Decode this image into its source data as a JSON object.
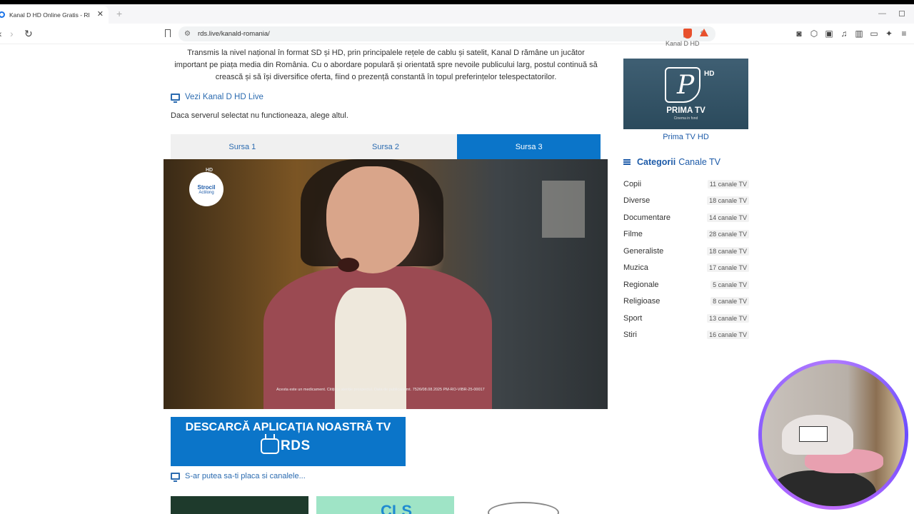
{
  "browser": {
    "tab_title": "Kanal D HD Online Gratis - RD",
    "tab_close": "✕",
    "new_tab": "+",
    "url": "rds.live/kanald-romania/",
    "window_min": "—"
  },
  "article": {
    "intro": "Transmis la nivel național în format SD și HD, prin principalele rețele de cablu și satelit, Kanal D rămâne un jucător important pe piața media din România. Cu o abordare populară și orientată spre nevoile publicului larg, postul continuă să crească și să își diversifice oferta, fiind o prezență constantă în topul preferințelor telespectatorilor.",
    "live_link": "Vezi Kanal D HD Live",
    "server_note": "Daca serverul selectat nu functioneaza, alege altul.",
    "sources": [
      "Sursa 1",
      "Sursa 2",
      "Sursa 3"
    ],
    "active_source": "Sursa 3",
    "video_logo_line1": "Strocil",
    "video_logo_line2": "Actilong",
    "video_logo_hd": "HD",
    "video_caption": "Acesta este un medicament. Citiți cu atenție prospectul. Data de publicare mt. 7526/08.08.2025 PM-RO-VIBR-25-00017",
    "app_banner_title": "DESCARCĂ APLICAȚIA NOASTRĂ TV",
    "app_banner_brand": "RDS",
    "related_link": "S-ar putea sa-ti placa si canalele...",
    "thumb_2_text": "CLS"
  },
  "sidebar": {
    "cut_label": "Kanal D HD",
    "prima_hd": "HD",
    "prima_word": "PRIMA TV",
    "prima_tag": "Cinema in fond",
    "prima_label": "Prima TV HD",
    "categories_title_strong": "Categorii",
    "categories_title_rest": "Canale TV",
    "categories": [
      {
        "name": "Copii",
        "count": "11 canale TV"
      },
      {
        "name": "Diverse",
        "count": "18 canale TV"
      },
      {
        "name": "Documentare",
        "count": "14 canale TV"
      },
      {
        "name": "Filme",
        "count": "28 canale TV"
      },
      {
        "name": "Generaliste",
        "count": "18 canale TV"
      },
      {
        "name": "Muzica",
        "count": "17 canale TV"
      },
      {
        "name": "Regionale",
        "count": "5 canale TV"
      },
      {
        "name": "Religioase",
        "count": "8 canale TV"
      },
      {
        "name": "Sport",
        "count": "13 canale TV"
      },
      {
        "name": "Stiri",
        "count": "16 canale TV"
      }
    ]
  },
  "colors": {
    "accent": "#0b75c9",
    "link": "#2b6bb0"
  }
}
